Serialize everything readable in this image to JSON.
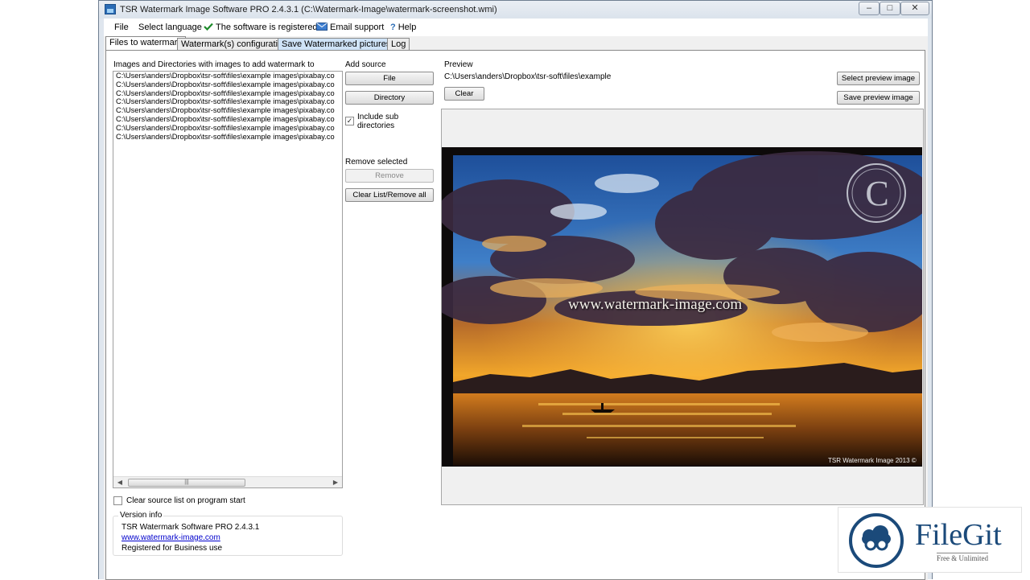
{
  "window": {
    "title": "TSR Watermark Image Software PRO 2.4.3.1 (C:\\Watermark-Image\\watermark-screenshot.wmi)",
    "min_glyph": "–",
    "max_glyph": "□",
    "close_glyph": "✕"
  },
  "menu": {
    "file": "File",
    "select_language": "Select language",
    "registered": "The software is registered",
    "email_support": "Email support",
    "help": "Help"
  },
  "tabs": [
    {
      "label": "Files to watermark"
    },
    {
      "label": "Watermark(s) configuration"
    },
    {
      "label": "Save Watermarked pictures as"
    },
    {
      "label": "Log"
    }
  ],
  "files": {
    "list_label": "Images and Directories with images to add watermark to",
    "items": [
      "C:\\Users\\anders\\Dropbox\\tsr-soft\\files\\example images\\pixabay.co",
      "C:\\Users\\anders\\Dropbox\\tsr-soft\\files\\example images\\pixabay.co",
      "C:\\Users\\anders\\Dropbox\\tsr-soft\\files\\example images\\pixabay.co",
      "C:\\Users\\anders\\Dropbox\\tsr-soft\\files\\example images\\pixabay.co",
      "C:\\Users\\anders\\Dropbox\\tsr-soft\\files\\example images\\pixabay.co",
      "C:\\Users\\anders\\Dropbox\\tsr-soft\\files\\example images\\pixabay.co",
      "C:\\Users\\anders\\Dropbox\\tsr-soft\\files\\example images\\pixabay.co",
      "C:\\Users\\anders\\Dropbox\\tsr-soft\\files\\example images\\pixabay.co"
    ],
    "clear_on_start_label": "Clear source list on program start",
    "clear_on_start_checked": false
  },
  "add_source": {
    "label": "Add source",
    "file_button": "File",
    "directory_button": "Directory",
    "include_sub_label_1": "Include sub",
    "include_sub_label_2": "directories",
    "include_sub_checked": true,
    "check_glyph": "✓"
  },
  "remove": {
    "label": "Remove selected",
    "remove_button": "Remove",
    "clear_all_button": "Clear List/Remove all"
  },
  "preview": {
    "label": "Preview",
    "path": "C:\\Users\\anders\\Dropbox\\tsr-soft\\files\\example",
    "clear_button": "Clear",
    "select_button": "Select preview image",
    "save_button": "Save preview image",
    "watermark_text": "www.watermark-image.com",
    "copyright_text": "TSR Watermark Image 2013 ©",
    "copyright_symbol": "C"
  },
  "version": {
    "title": "Version info",
    "product": "TSR Watermark Software PRO 2.4.3.1",
    "url": "www.watermark-image.com",
    "license": "Registered for Business use"
  },
  "badge": {
    "name": "FileGit",
    "tagline": "Free & Unlimited"
  },
  "colors": {
    "accent": "#2b6cb5",
    "tab_highlight": "#cfe3f7",
    "link": "#0000cc"
  }
}
